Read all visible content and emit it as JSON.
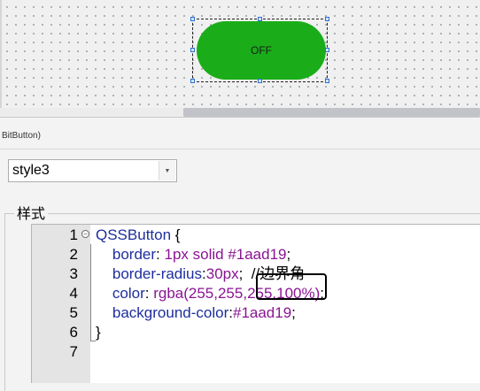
{
  "designer": {
    "button_text": "OFF",
    "button_color": "#1aad19"
  },
  "class_label": "BitButton)",
  "style_combo": {
    "value": "style3"
  },
  "group": {
    "title": "样式"
  },
  "editor": {
    "lines": [
      {
        "num": "1",
        "parts": [
          {
            "t": "QSSButton",
            "c": "kw"
          },
          {
            "t": " {",
            "c": "pun"
          }
        ]
      },
      {
        "num": "2",
        "parts": [
          {
            "t": "    border",
            "c": "kw"
          },
          {
            "t": ": ",
            "c": "pun"
          },
          {
            "t": "1px solid #1aad19",
            "c": "val"
          },
          {
            "t": ";",
            "c": "pun"
          }
        ]
      },
      {
        "num": "3",
        "parts": [
          {
            "t": "    border-radius",
            "c": "kw"
          },
          {
            "t": ":",
            "c": "pun"
          },
          {
            "t": "30px",
            "c": "val"
          },
          {
            "t": ";  ",
            "c": "pun"
          },
          {
            "t": "//边界角",
            "c": "cmt"
          }
        ]
      },
      {
        "num": "4",
        "parts": [
          {
            "t": "    color",
            "c": "kw"
          },
          {
            "t": ": ",
            "c": "pun"
          },
          {
            "t": "rgba(255,255,255,100%)",
            "c": "val"
          },
          {
            "t": ";",
            "c": "pun"
          }
        ]
      },
      {
        "num": "5",
        "parts": [
          {
            "t": "    background-color",
            "c": "kw"
          },
          {
            "t": ":",
            "c": "pun"
          },
          {
            "t": "#1aad19",
            "c": "val"
          },
          {
            "t": ";",
            "c": "pun"
          }
        ]
      },
      {
        "num": "6",
        "parts": [
          {
            "t": "}",
            "c": "pun"
          }
        ]
      },
      {
        "num": "7",
        "parts": []
      }
    ]
  }
}
